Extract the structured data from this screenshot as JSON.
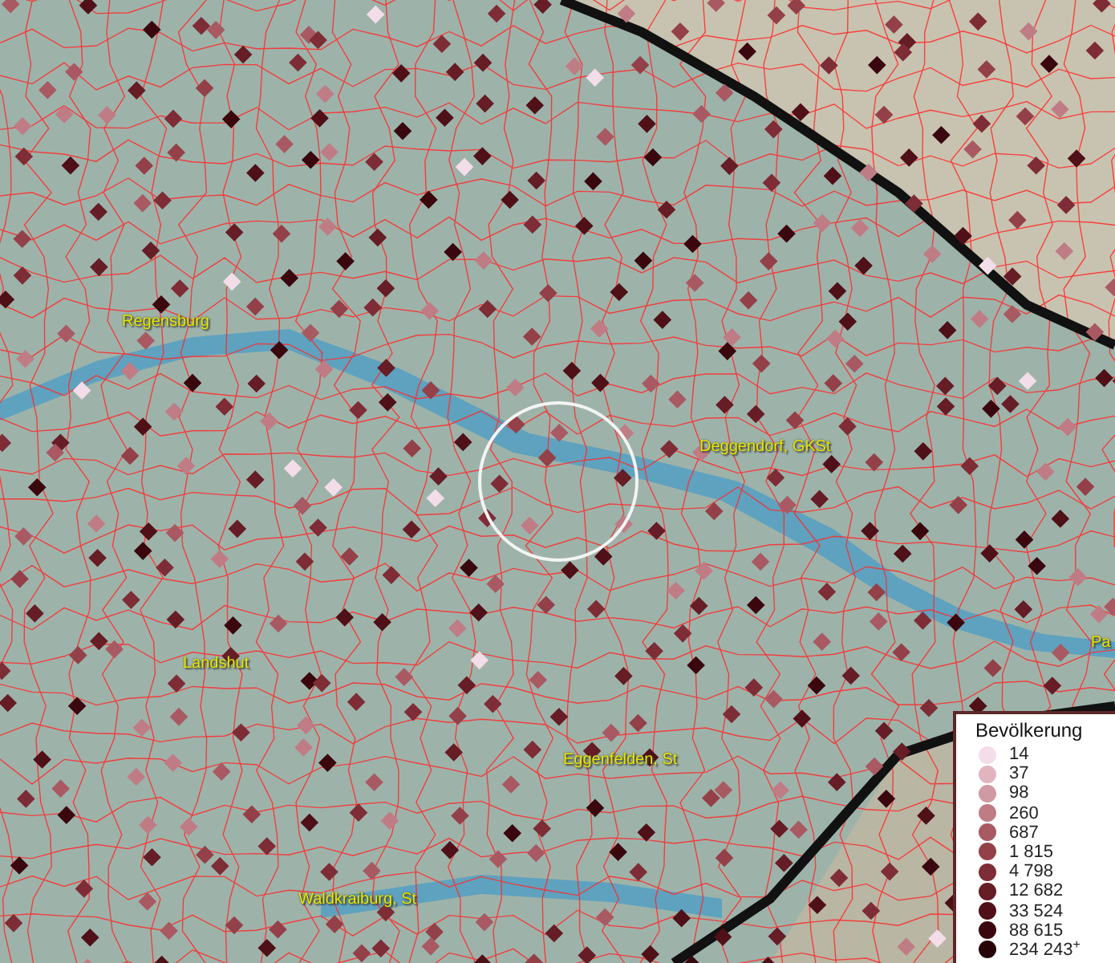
{
  "map": {
    "places": [
      {
        "name": "Regensburg"
      },
      {
        "name": "Deggendorf, GKSt"
      },
      {
        "name": "Landshut"
      },
      {
        "name": "Eggenfelden, St"
      },
      {
        "name": "Waldkraiburg, St"
      },
      {
        "name": "Pa"
      }
    ]
  },
  "legend": {
    "title": "Bevölkerung",
    "items": [
      {
        "label": "14",
        "color": "#f3dde8"
      },
      {
        "label": "37",
        "color": "#e2b4c0"
      },
      {
        "label": "98",
        "color": "#cf9aa3"
      },
      {
        "label": "260",
        "color": "#bf7c85"
      },
      {
        "label": "687",
        "color": "#a95962"
      },
      {
        "label": "1 815",
        "color": "#944048"
      },
      {
        "label": "4 798",
        "color": "#7e2c35"
      },
      {
        "label": "12 682",
        "color": "#661d25"
      },
      {
        "label": "33 524",
        "color": "#4f1018"
      },
      {
        "label": "88 615",
        "color": "#3a070e"
      },
      {
        "label": "234 243$^{+}$",
        "color": "#260307"
      }
    ]
  }
}
